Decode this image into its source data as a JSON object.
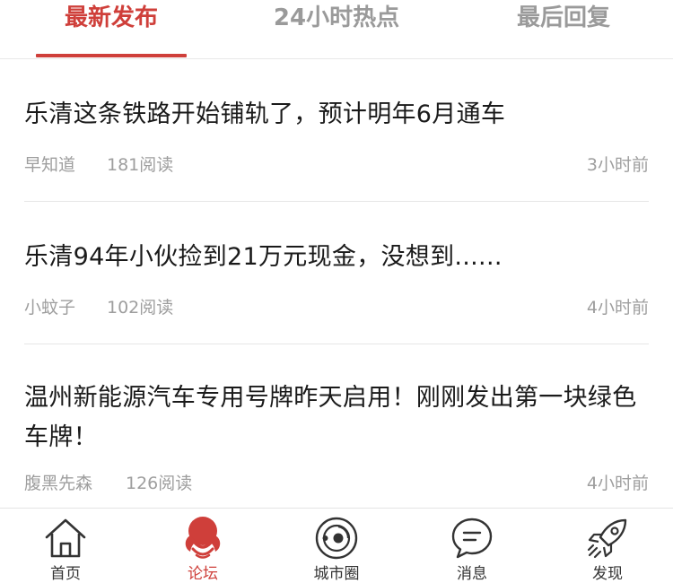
{
  "tabs": [
    {
      "label": "最新发布",
      "active": true
    },
    {
      "label": "24小时热点",
      "active": false
    },
    {
      "label": "最后回复",
      "active": false
    }
  ],
  "articles": [
    {
      "title": "乐清这条铁路开始铺轨了，预计明年6月通车",
      "author": "早知道",
      "reads": "181阅读",
      "time": "3小时前"
    },
    {
      "title": "乐清94年小伙捡到21万元现金，没想到......",
      "author": "小蚊子",
      "reads": "102阅读",
      "time": "4小时前"
    },
    {
      "title": "温州新能源汽车专用号牌昨天启用！刚刚发出第一块绿色车牌！",
      "author": "腹黑先森",
      "reads": "126阅读",
      "time": "4小时前"
    }
  ],
  "nav": [
    {
      "label": "首页",
      "icon": "home-icon"
    },
    {
      "label": "论坛",
      "icon": "forum-icon",
      "active": true
    },
    {
      "label": "城市圈",
      "icon": "city-circle-icon"
    },
    {
      "label": "消息",
      "icon": "message-icon"
    },
    {
      "label": "发现",
      "icon": "rocket-icon"
    }
  ],
  "colors": {
    "accent": "#cf3f3a",
    "tab_inactive": "#9a9a9a",
    "title_text": "#1a1a1a",
    "meta_text": "#9e9e9e",
    "divider": "#e6e6e6"
  }
}
